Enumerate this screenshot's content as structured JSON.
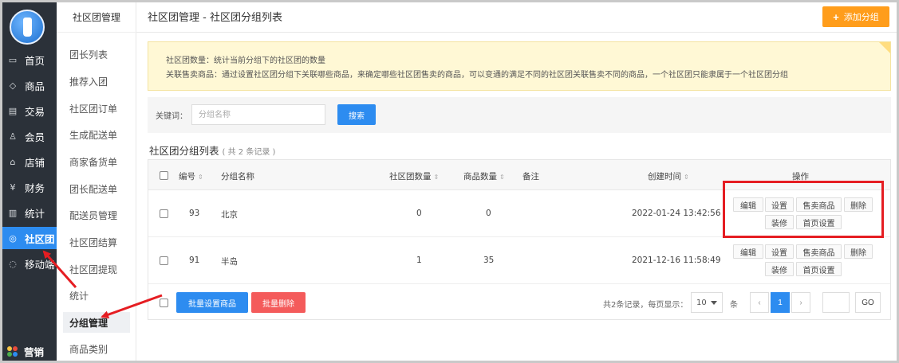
{
  "nav": {
    "items": [
      {
        "label": "首页",
        "icon": "monitor-icon"
      },
      {
        "label": "商品",
        "icon": "tag-icon"
      },
      {
        "label": "交易",
        "icon": "document-icon"
      },
      {
        "label": "会员",
        "icon": "user-icon"
      },
      {
        "label": "店铺",
        "icon": "store-icon"
      },
      {
        "label": "财务",
        "icon": "yen-icon"
      },
      {
        "label": "统计",
        "icon": "bar-chart-icon"
      },
      {
        "label": "社区团",
        "icon": "community-icon"
      },
      {
        "label": "移动端",
        "icon": "chat-icon"
      }
    ],
    "marketing_label": "营销",
    "active_color": "#2d8cf0"
  },
  "subnav": {
    "title": "社区团管理",
    "items": [
      "团长列表",
      "推荐入团",
      "社区团订单",
      "生成配送单",
      "商家备货单",
      "团长配送单",
      "配送员管理",
      "社区团结算",
      "社区团提现",
      "统计",
      "分组管理",
      "商品类别"
    ],
    "active": "分组管理"
  },
  "header": {
    "title": "社区团管理 - 社区团分组列表",
    "add_button": "添加分组",
    "add_button_color": "#ff9d1b"
  },
  "notice": {
    "line1": "社区团数量：统计当前分组下的社区团的数量",
    "line2": "关联售卖商品：通过设置社区团分组下关联哪些商品，来确定哪些社区团售卖的商品，可以变通的满足不同的社区团关联售卖不同的商品，一个社区团只能隶属于一个社区团分组"
  },
  "search": {
    "label": "关键词：",
    "placeholder": "分组名称",
    "button": "搜索"
  },
  "list": {
    "title": "社区团分组列表",
    "count_text": "( 共 2 条记录 )",
    "columns": {
      "id": "编号",
      "name": "分组名称",
      "community_count": "社区团数量",
      "product_count": "商品数量",
      "remark": "备注",
      "created": "创建时间",
      "actions": "操作"
    },
    "rows": [
      {
        "id": "93",
        "name": "北京",
        "community_count": "0",
        "product_count": "0",
        "remark": "",
        "created": "2022-01-24 13:42:56"
      },
      {
        "id": "91",
        "name": "半岛",
        "community_count": "1",
        "product_count": "35",
        "remark": "",
        "created": "2021-12-16 11:58:49"
      }
    ],
    "row_actions": [
      "编辑",
      "设置",
      "售卖商品",
      "删除",
      "装修",
      "首页设置"
    ]
  },
  "footer": {
    "batch_set": "批量设置商品",
    "batch_delete": "批量删除",
    "batch_set_color": "#2d8cf0",
    "batch_delete_color": "#f45b5b",
    "page_info": "共2条记录，每页显示：",
    "page_size": "10",
    "page_unit": "条",
    "prev": "‹",
    "current_page": "1",
    "next": "›",
    "go": "GO"
  },
  "annotation": {
    "highlight_color": "#e51d22"
  }
}
